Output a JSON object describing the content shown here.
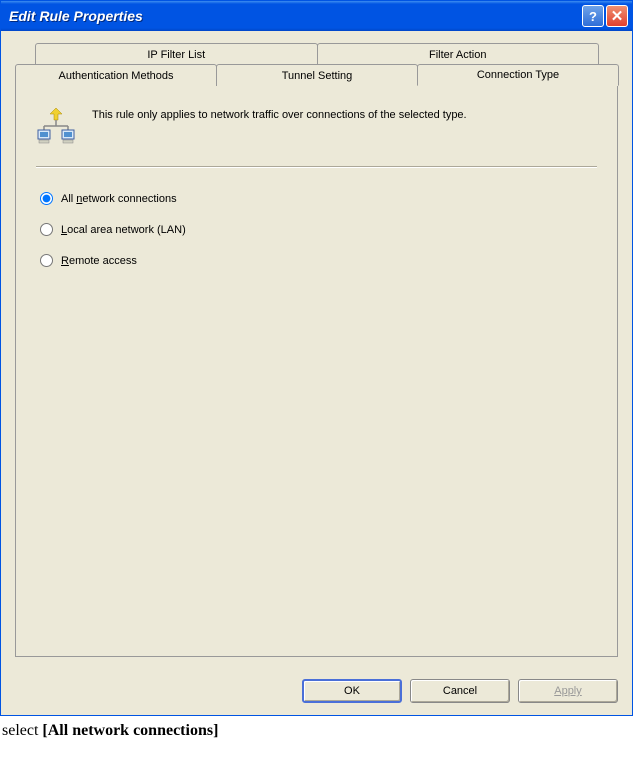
{
  "titlebar": {
    "title": "Edit Rule Properties"
  },
  "tabs_row1": [
    {
      "label": "IP Filter List"
    },
    {
      "label": "Filter Action"
    }
  ],
  "tabs_row2": [
    {
      "label": "Authentication Methods"
    },
    {
      "label": "Tunnel Setting"
    },
    {
      "label": "Connection Type",
      "active": true
    }
  ],
  "info_text": "This rule only applies to network traffic over connections of the selected type.",
  "radios": [
    {
      "label_pre": "All ",
      "accel": "n",
      "label_post": "etwork connections",
      "checked": true
    },
    {
      "label_pre": "",
      "accel": "L",
      "label_post": "ocal area network (LAN)",
      "checked": false
    },
    {
      "label_pre": "",
      "accel": "R",
      "label_post": "emote access",
      "checked": false
    }
  ],
  "buttons": {
    "ok": "OK",
    "cancel": "Cancel",
    "apply": "Apply"
  },
  "caption": {
    "prefix": "select ",
    "bold": "[All network connections]"
  }
}
